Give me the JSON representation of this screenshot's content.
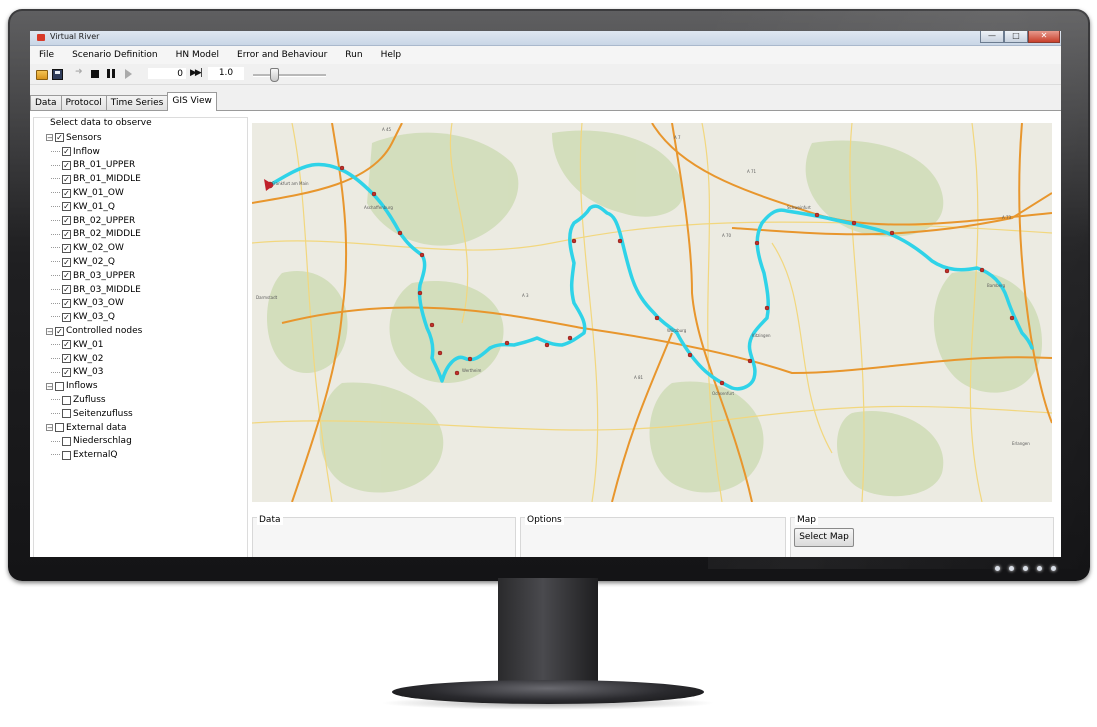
{
  "window": {
    "title": "Virtual River",
    "controls": [
      "—",
      "□",
      "✕"
    ]
  },
  "menu": [
    "File",
    "Scenario Definition",
    "HN Model",
    "Error and Behaviour",
    "Run",
    "Help"
  ],
  "toolbar": {
    "step_value": "0",
    "speed_value": "1.0",
    "speed_slider_level": 0.3
  },
  "tabs": [
    {
      "label": "Data",
      "active": false
    },
    {
      "label": "Protocol",
      "active": false
    },
    {
      "label": "Time Series",
      "active": false
    },
    {
      "label": "GIS View",
      "active": true
    }
  ],
  "tree": {
    "title": "Select data to observe",
    "groups": [
      {
        "label": "Sensors",
        "checked": true,
        "children": [
          {
            "label": "Inflow",
            "checked": true
          },
          {
            "label": "BR_01_UPPER",
            "checked": true
          },
          {
            "label": "BR_01_MIDDLE",
            "checked": true
          },
          {
            "label": "KW_01_OW",
            "checked": true
          },
          {
            "label": "KW_01_Q",
            "checked": true
          },
          {
            "label": "BR_02_UPPER",
            "checked": true
          },
          {
            "label": "BR_02_MIDDLE",
            "checked": true
          },
          {
            "label": "KW_02_OW",
            "checked": true
          },
          {
            "label": "KW_02_Q",
            "checked": true
          },
          {
            "label": "BR_03_UPPER",
            "checked": true
          },
          {
            "label": "BR_03_MIDDLE",
            "checked": true
          },
          {
            "label": "KW_03_OW",
            "checked": true
          },
          {
            "label": "KW_03_Q",
            "checked": true
          }
        ]
      },
      {
        "label": "Controlled nodes",
        "checked": true,
        "children": [
          {
            "label": "KW_01",
            "checked": true
          },
          {
            "label": "KW_02",
            "checked": true
          },
          {
            "label": "KW_03",
            "checked": true
          }
        ]
      },
      {
        "label": "Inflows",
        "checked": false,
        "children": [
          {
            "label": "Zufluss",
            "checked": false
          },
          {
            "label": "Seitenzufluss",
            "checked": false
          }
        ]
      },
      {
        "label": "External data",
        "checked": false,
        "children": [
          {
            "label": "Niederschlag",
            "checked": false
          },
          {
            "label": "ExternalQ",
            "checked": false
          }
        ]
      }
    ]
  },
  "map": {
    "labels": [
      "A 45",
      "A 7",
      "A 71",
      "A 3",
      "A 81",
      "A 70",
      "A 73",
      "Frankfurt am Main",
      "Darmstadt",
      "Würzburg",
      "Schweinfurt",
      "Bamberg",
      "Erlangen",
      "Aschaffenburg",
      "Wertheim",
      "Kitzingen",
      "Ochsenfurt"
    ],
    "colors": {
      "river": "#2fd3e8",
      "sensor": "#c0302a",
      "motorway": "#e8962d",
      "road": "#f2d77e",
      "forest": "#cfdcb6",
      "background": "#ecebe2"
    }
  },
  "bottom": {
    "data_title": "Data",
    "options_title": "Options",
    "map_title": "Map",
    "select_map_label": "Select Map"
  }
}
